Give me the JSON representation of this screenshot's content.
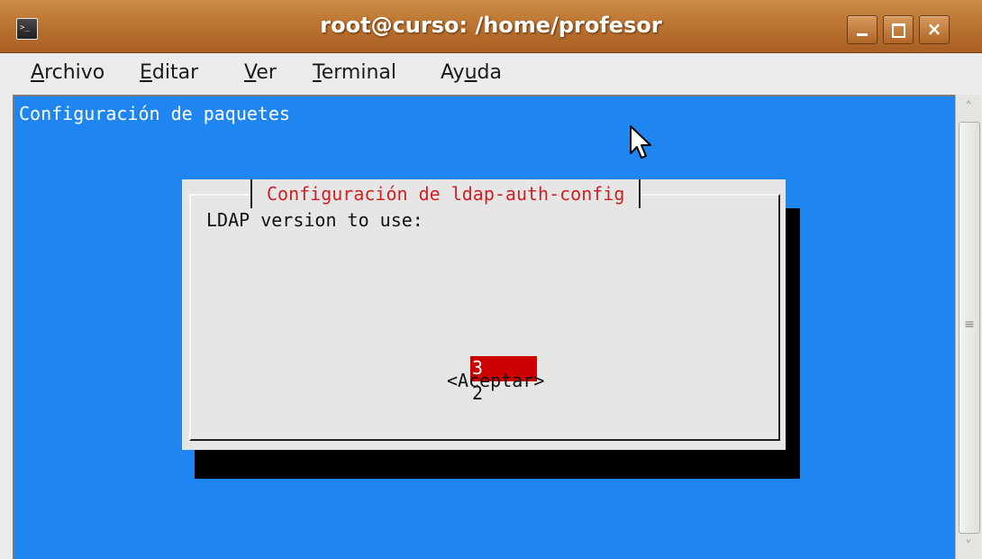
{
  "window": {
    "title": "root@curso: /home/profesor",
    "icon": "terminal-icon",
    "controls": {
      "minimize": "minimize-icon",
      "maximize": "maximize-icon",
      "close": "×"
    }
  },
  "menu": {
    "items": [
      {
        "pre": "",
        "mnemonic": "A",
        "post": "rchivo"
      },
      {
        "pre": "",
        "mnemonic": "E",
        "post": "ditar"
      },
      {
        "pre": "",
        "mnemonic": "V",
        "post": "er"
      },
      {
        "pre": "",
        "mnemonic": "T",
        "post": "erminal"
      },
      {
        "pre": "Ay",
        "mnemonic": "u",
        "post": "da"
      }
    ]
  },
  "terminal": {
    "backtitle": "Configuración de paquetes",
    "background_color": "#1f85f0",
    "dialog": {
      "title": "Configuración de ldap-auth-config",
      "prompt": "LDAP version to use:",
      "options": [
        "3",
        "2"
      ],
      "selected": "3",
      "accept_button": "<Aceptar>",
      "title_color": "#cc2222",
      "highlight_color": "#cc0000"
    }
  },
  "scrollbar": {
    "up": "˄",
    "down": "˅",
    "grip": "≡"
  },
  "cursor": "arrow-cursor-icon"
}
